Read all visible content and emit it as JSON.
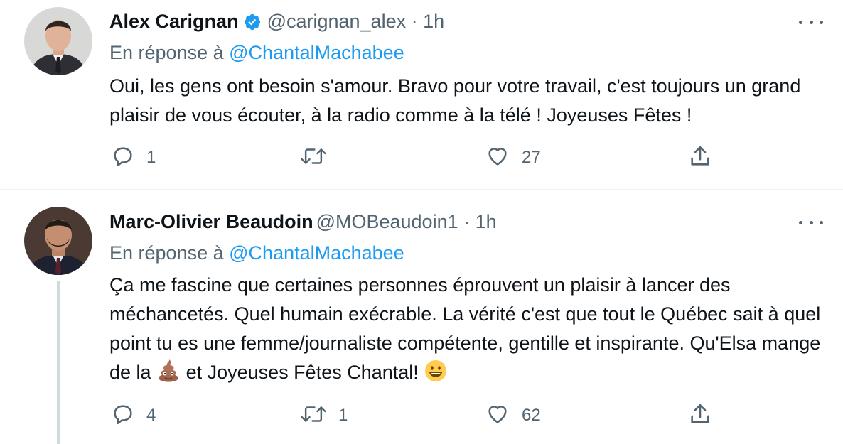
{
  "tweets": [
    {
      "author_name": "Alex Carignan",
      "handle": "@carignan_alex",
      "separator": "·",
      "time": "1h",
      "verified": true,
      "reply_prefix": "En réponse à",
      "reply_to": "@ChantalMachabee",
      "text": "Oui, les gens ont besoin s'amour. Bravo pour votre travail, c'est toujours un grand plaisir de vous écouter, à la radio comme à la télé ! Joyeuses Fêtes !",
      "replies": "1",
      "retweets": "",
      "likes": "27"
    },
    {
      "author_name": "Marc-Olivier Beaudoin",
      "handle": "@MOBeaudoin1",
      "separator": "·",
      "time": "1h",
      "verified": false,
      "reply_prefix": "En réponse à",
      "reply_to": "@ChantalMachabee",
      "text_part1": "Ça me fascine que certaines personnes éprouvent un plaisir à lancer des méchancetés. Quel humain exécrable. La vérité c'est que tout le Québec sait à quel point tu es une femme/journaliste compétente, gentille et inspirante. Qu'Elsa mange de la",
      "text_part2": "et Joyeuses Fêtes Chantal!",
      "replies": "4",
      "retweets": "1",
      "likes": "62"
    }
  ],
  "icons": {
    "verified": "verified-badge-icon",
    "reply": "reply-bubble-icon",
    "retweet": "retweet-icon",
    "like": "heart-icon",
    "share": "share-upload-icon",
    "more": "more-dots-icon",
    "emoji_1": "pile-of-poo-emoji",
    "emoji_2": "grinning-face-emoji"
  },
  "colors": {
    "link": "#1d9bf0",
    "secondary_text": "#536471",
    "primary_text": "#0f1419",
    "divider": "#eff3f4",
    "thread_line": "#cfd9de"
  }
}
